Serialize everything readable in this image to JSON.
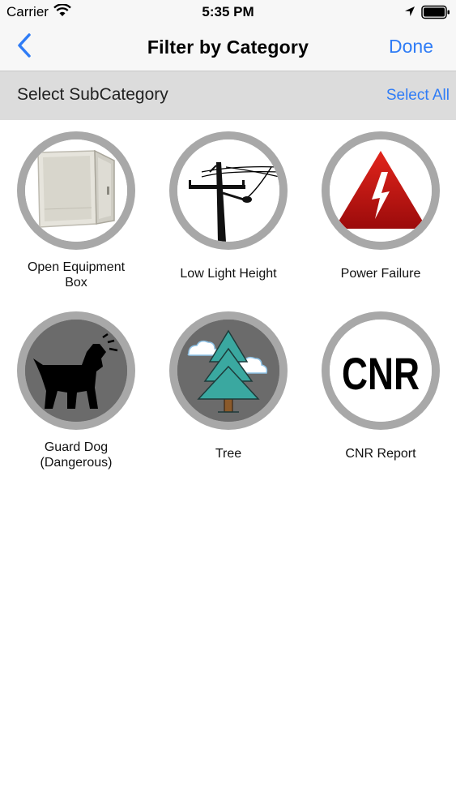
{
  "status_bar": {
    "carrier": "Carrier",
    "time": "5:35 PM"
  },
  "nav": {
    "title": "Filter by Category",
    "done_label": "Done"
  },
  "subheader": {
    "title": "Select SubCategory",
    "select_all_label": "Select All"
  },
  "categories": [
    {
      "label": "Open Equipment Box",
      "icon": "equipment-box-icon"
    },
    {
      "label": "Low Light Height",
      "icon": "power-pole-icon"
    },
    {
      "label": "Power Failure",
      "icon": "high-voltage-warning-icon"
    },
    {
      "label": "Guard  Dog (Dangerous)",
      "icon": "barking-dog-icon"
    },
    {
      "label": "Tree",
      "icon": "tree-icon"
    },
    {
      "label": "CNR Report",
      "icon": "cnr-icon",
      "icon_text": "CNR"
    }
  ],
  "colors": {
    "accent": "#2f7cf6",
    "ring": "#a8a8a8",
    "subheader_bg": "#dcdcdc"
  }
}
